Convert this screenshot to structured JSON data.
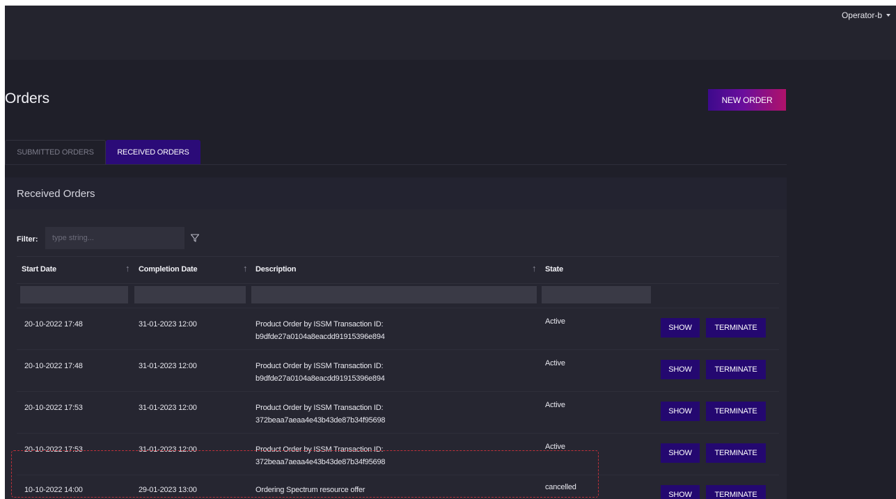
{
  "header": {
    "user": "Operator-b"
  },
  "page": {
    "title": "Orders",
    "new_order_label": "NEW ORDER"
  },
  "tabs": [
    {
      "label": "SUBMITTED ORDERS",
      "active": false
    },
    {
      "label": "RECEIVED ORDERS",
      "active": true
    }
  ],
  "panel": {
    "title": "Received Orders"
  },
  "filter": {
    "label": "Filter:",
    "placeholder": "type string...",
    "icon": "filter-icon"
  },
  "table": {
    "columns": [
      "Start Date",
      "Completion Date",
      "Description",
      "State"
    ],
    "rows": [
      {
        "start_date": "20-10-2022 17:48",
        "completion_date": "31-01-2023 12:00",
        "description_line1": "Product Order by ISSM Transaction ID:",
        "description_line2": "b9dfde27a0104a8eacdd91915396e894",
        "state": "Active",
        "show_label": "SHOW",
        "terminate_label": "TERMINATE"
      },
      {
        "start_date": "20-10-2022 17:48",
        "completion_date": "31-01-2023 12:00",
        "description_line1": "Product Order by ISSM Transaction ID:",
        "description_line2": "b9dfde27a0104a8eacdd91915396e894",
        "state": "Active",
        "show_label": "SHOW",
        "terminate_label": "TERMINATE"
      },
      {
        "start_date": "20-10-2022 17:53",
        "completion_date": "31-01-2023 12:00",
        "description_line1": "Product Order by ISSM Transaction ID:",
        "description_line2": "372beaa7aeaa4e43b43de87b34f95698",
        "state": "Active",
        "show_label": "SHOW",
        "terminate_label": "TERMINATE"
      },
      {
        "start_date": "20-10-2022 17:53",
        "completion_date": "31-01-2023 12:00",
        "description_line1": "Product Order by ISSM Transaction ID:",
        "description_line2": "372beaa7aeaa4e43b43de87b34f95698",
        "state": "Active",
        "show_label": "SHOW",
        "terminate_label": "TERMINATE"
      },
      {
        "start_date": "10-10-2022 14:00",
        "completion_date": "29-01-2023 13:00",
        "description_line1": "Ordering Spectrum resource offer",
        "description_line2": "",
        "state": "cancelled",
        "show_label": "SHOW",
        "terminate_label": "TERMINATE"
      }
    ]
  },
  "colors": {
    "background": "#1f1f29",
    "topbar": "#24242e",
    "active_tab": "#2b0b78",
    "button": "#240870",
    "new_order_gradient": [
      "#3d0a8c",
      "#b0126a"
    ],
    "highlight_outline": "#c0303a"
  }
}
